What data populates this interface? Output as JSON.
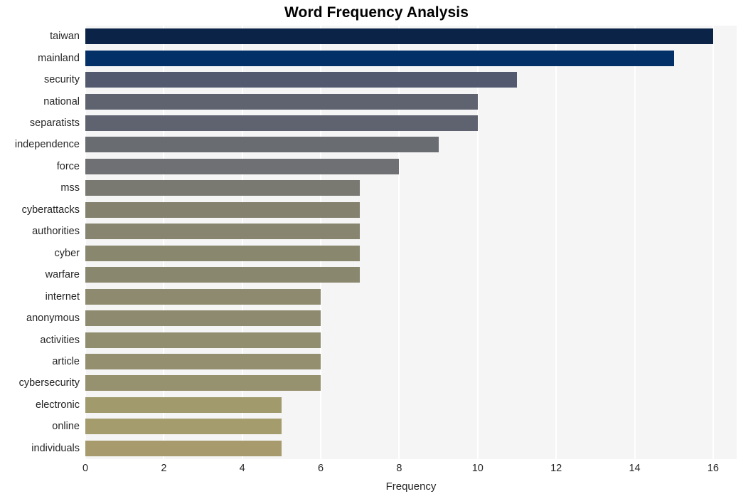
{
  "chart_data": {
    "type": "bar",
    "orientation": "horizontal",
    "title": "Word Frequency Analysis",
    "xlabel": "Frequency",
    "ylabel": "",
    "xlim": [
      0,
      16.6
    ],
    "xticks": [
      0,
      2,
      4,
      6,
      8,
      10,
      12,
      14,
      16
    ],
    "xtick_labels": [
      "0",
      "2",
      "4",
      "6",
      "8",
      "10",
      "12",
      "14",
      "16"
    ],
    "grid": "vertical-white-on-light-gray",
    "legend": "none",
    "categories": [
      "taiwan",
      "mainland",
      "security",
      "national",
      "separatists",
      "independence",
      "force",
      "mss",
      "cyberattacks",
      "authorities",
      "cyber",
      "warfare",
      "internet",
      "anonymous",
      "activities",
      "article",
      "cybersecurity",
      "electronic",
      "online",
      "individuals"
    ],
    "values": [
      16,
      15,
      11,
      10,
      10,
      9,
      8,
      7,
      7,
      7,
      7,
      7,
      6,
      6,
      6,
      6,
      6,
      5,
      5,
      5
    ],
    "bar_colors": [
      "#0a2347",
      "#043068",
      "#535a70",
      "#5f6370",
      "#5f6370",
      "#696c71",
      "#6f7073",
      "#797871",
      "#84826f",
      "#87856f",
      "#8a876f",
      "#8a876f",
      "#8e8a6f",
      "#8e8a6f",
      "#918d6f",
      "#938f6f",
      "#96916f",
      "#a19a6d",
      "#a49c6d",
      "#a79b6d"
    ],
    "plot_background": "#f5f5f5",
    "gridline_color": "#ffffff",
    "figure_background": "#ffffff",
    "text_color": "#262626"
  }
}
